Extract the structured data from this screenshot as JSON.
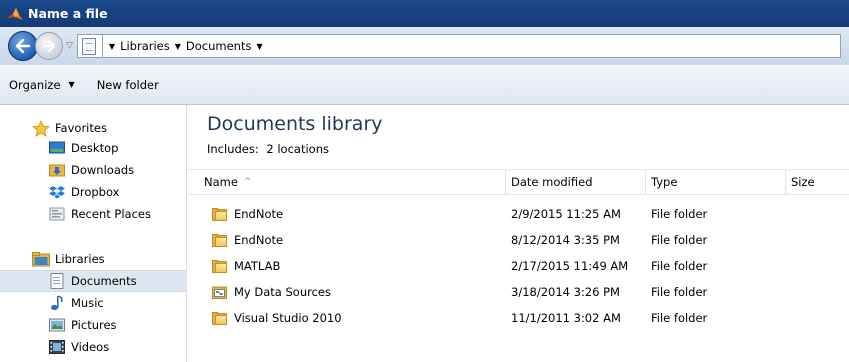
{
  "window": {
    "title": "Name a file"
  },
  "address": {
    "crumbs": [
      "Libraries",
      "Documents",
      ""
    ]
  },
  "toolbar": {
    "organize_label": "Organize",
    "new_folder_label": "New folder"
  },
  "nav": {
    "favorites_label": "Favorites",
    "favorites": [
      {
        "label": "Desktop",
        "icon": "desktop-icon"
      },
      {
        "label": "Downloads",
        "icon": "downloads-icon"
      },
      {
        "label": "Dropbox",
        "icon": "dropbox-icon"
      },
      {
        "label": "Recent Places",
        "icon": "recent-places-icon"
      }
    ],
    "libraries_label": "Libraries",
    "libraries": [
      {
        "label": "Documents",
        "icon": "documents-icon",
        "selected": true
      },
      {
        "label": "Music",
        "icon": "music-icon"
      },
      {
        "label": "Pictures",
        "icon": "pictures-icon"
      },
      {
        "label": "Videos",
        "icon": "videos-icon"
      }
    ]
  },
  "library": {
    "title": "Documents library",
    "includes_label": "Includes:",
    "includes_count": "2 locations"
  },
  "columns": {
    "name": "Name",
    "date": "Date modified",
    "type": "Type",
    "size": "Size"
  },
  "files": [
    {
      "name": "EndNote",
      "date": "2/9/2015 11:25 AM",
      "type": "File folder",
      "icon": "folder-icon"
    },
    {
      "name": "EndNote",
      "date": "8/12/2014 3:35 PM",
      "type": "File folder",
      "icon": "folder-icon"
    },
    {
      "name": "MATLAB",
      "date": "2/17/2015 11:49 AM",
      "type": "File folder",
      "icon": "folder-icon"
    },
    {
      "name": "My Data Sources",
      "date": "3/18/2014 3:26 PM",
      "type": "File folder",
      "icon": "data-sources-folder-icon"
    },
    {
      "name": "Visual Studio 2010",
      "date": "11/1/2011 3:02 AM",
      "type": "File folder",
      "icon": "folder-icon"
    }
  ],
  "colors": {
    "title_bar": "#1c4a8c",
    "selection": "#dde6f1",
    "library_title": "#1e395b"
  }
}
